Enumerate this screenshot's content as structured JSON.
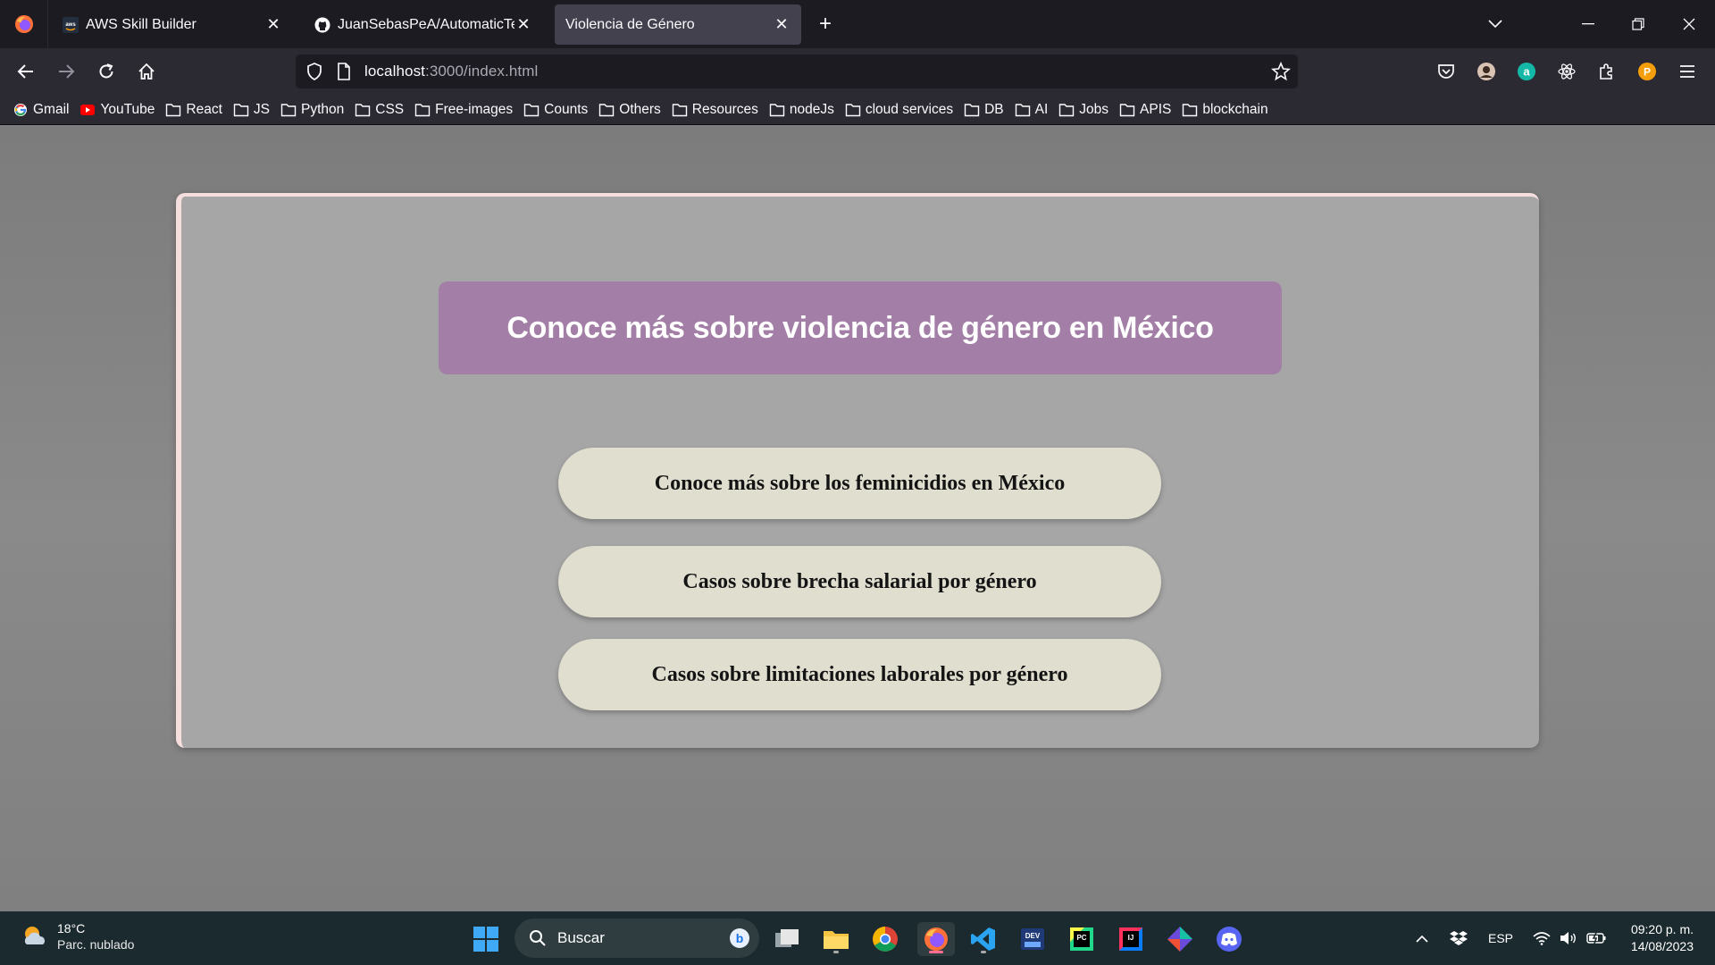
{
  "browser": {
    "tabs": [
      {
        "title": "AWS Skill Builder",
        "icon": "aws-icon"
      },
      {
        "title": "JuanSebasPeA/AutomaticTextG",
        "icon": "github-icon"
      },
      {
        "title": "Violencia de Género",
        "icon": "none",
        "active": true
      }
    ],
    "url_host": "localhost",
    "url_path": ":3000/index.html",
    "bookmarks": [
      {
        "label": "Gmail",
        "icon": "google-icon"
      },
      {
        "label": "YouTube",
        "icon": "youtube-icon"
      },
      {
        "label": "React",
        "icon": "folder-icon"
      },
      {
        "label": "JS",
        "icon": "folder-icon"
      },
      {
        "label": "Python",
        "icon": "folder-icon"
      },
      {
        "label": "CSS",
        "icon": "folder-icon"
      },
      {
        "label": "Free-images",
        "icon": "folder-icon"
      },
      {
        "label": "Counts",
        "icon": "folder-icon"
      },
      {
        "label": "Others",
        "icon": "folder-icon"
      },
      {
        "label": "Resources",
        "icon": "folder-icon"
      },
      {
        "label": "nodeJs",
        "icon": "folder-icon"
      },
      {
        "label": "cloud services",
        "icon": "folder-icon"
      },
      {
        "label": "DB",
        "icon": "folder-icon"
      },
      {
        "label": "AI",
        "icon": "folder-icon"
      },
      {
        "label": "Jobs",
        "icon": "folder-icon"
      },
      {
        "label": "APIS",
        "icon": "folder-icon"
      },
      {
        "label": "blockchain",
        "icon": "folder-icon"
      }
    ]
  },
  "page": {
    "heading": "Conoce más sobre violencia de género en México",
    "buttons": [
      "Conoce más sobre los feminicidios en México",
      "Casos sobre brecha salarial por género",
      "Casos sobre limitaciones laborales por género"
    ],
    "colors": {
      "hero": "#a37ea6",
      "card": "#a6a6a6",
      "button": "#e0decf"
    }
  },
  "taskbar": {
    "weather_temp": "18°C",
    "weather_condition": "Parc. nublado",
    "search_placeholder": "Buscar",
    "language": "ESP",
    "time": "09:20 p. m.",
    "date": "14/08/2023"
  }
}
